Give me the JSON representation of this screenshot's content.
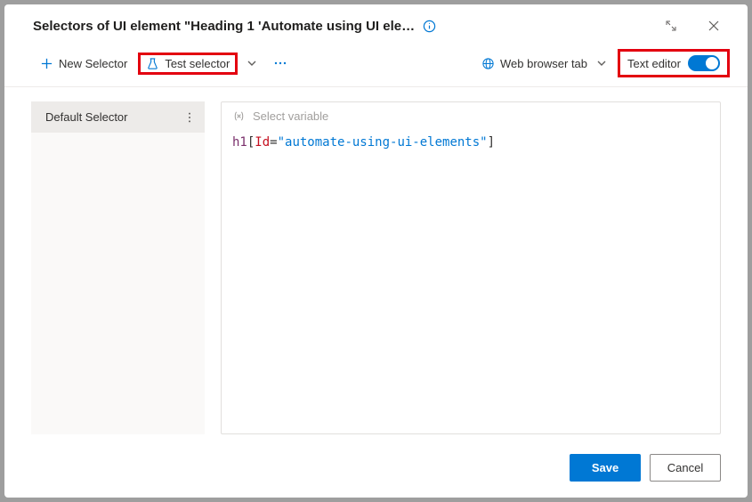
{
  "titlebar": {
    "title": "Selectors of UI element \"Heading 1 'Automate using UI elemen..."
  },
  "toolbar": {
    "new_selector_label": "New Selector",
    "test_selector_label": "Test selector",
    "web_browser_tab_label": "Web browser tab",
    "text_editor_label": "Text editor"
  },
  "sidebar": {
    "items": [
      {
        "label": "Default Selector"
      }
    ]
  },
  "editor": {
    "variable_placeholder": "Select variable",
    "code": {
      "tag": "h1",
      "open_bracket": "[",
      "attr": "Id",
      "eq": "=",
      "value": "\"automate-using-ui-elements\"",
      "close_bracket": "]"
    }
  },
  "footer": {
    "save_label": "Save",
    "cancel_label": "Cancel"
  }
}
